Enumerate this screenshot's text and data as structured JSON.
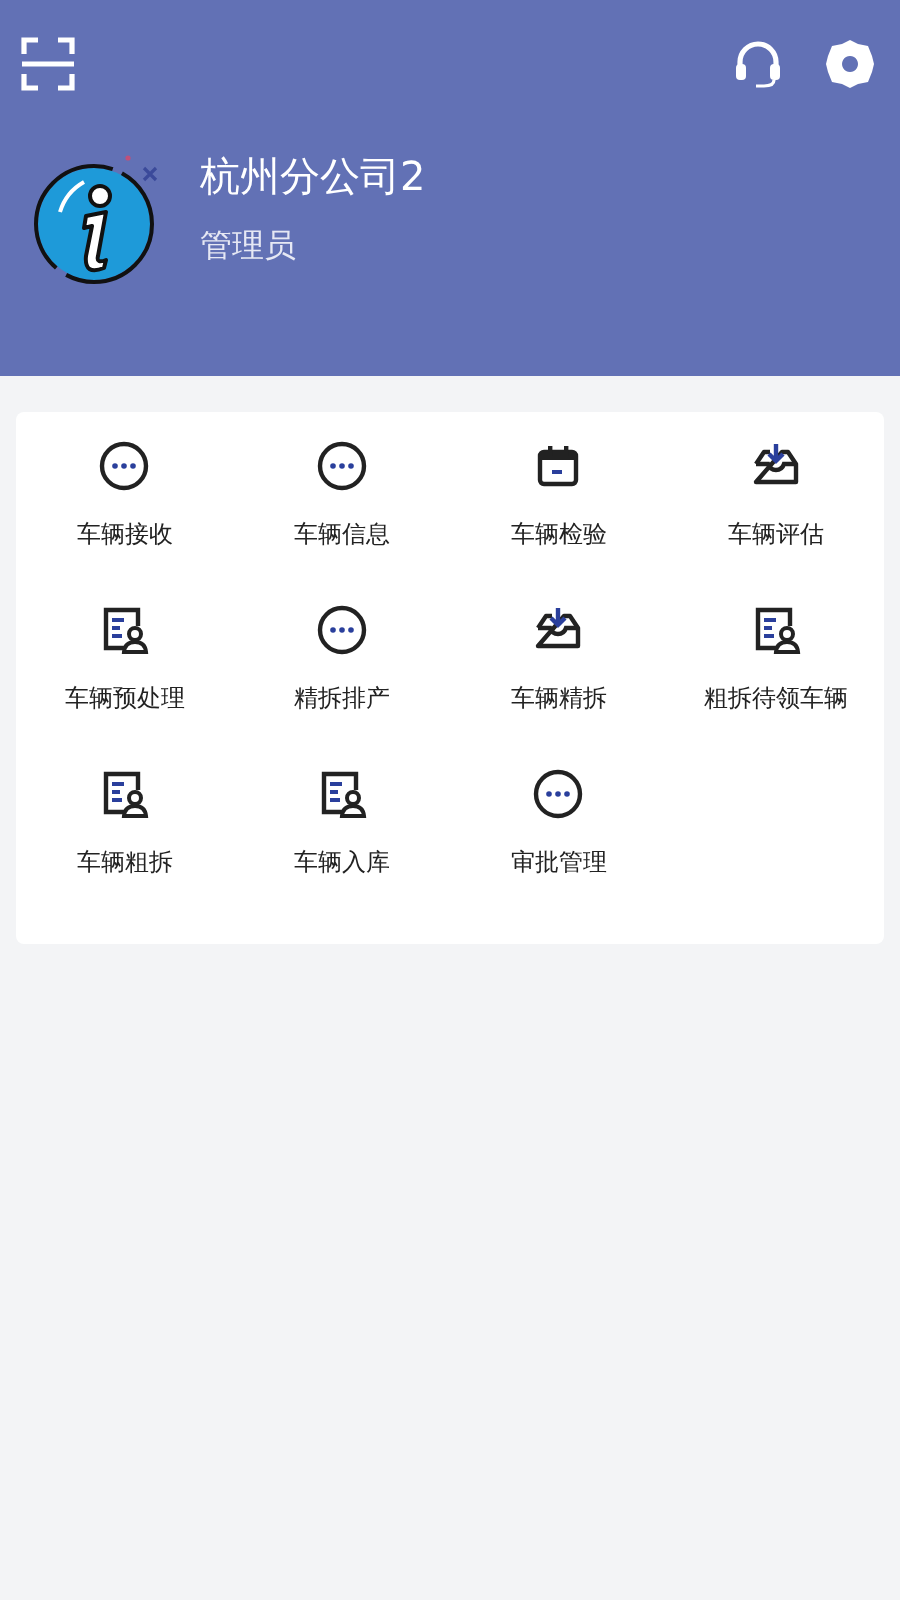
{
  "header": {
    "company": "杭州分公司2",
    "role": "管理员"
  },
  "menu": [
    {
      "label": "车辆接收",
      "kind": "dots"
    },
    {
      "label": "车辆信息",
      "kind": "dots"
    },
    {
      "label": "车辆检验",
      "kind": "calendar"
    },
    {
      "label": "车辆评估",
      "kind": "inbox"
    },
    {
      "label": "车辆预处理",
      "kind": "doc-user"
    },
    {
      "label": "精拆排产",
      "kind": "dots"
    },
    {
      "label": "车辆精拆",
      "kind": "inbox"
    },
    {
      "label": "粗拆待领车辆",
      "kind": "doc-user"
    },
    {
      "label": "车辆粗拆",
      "kind": "doc-user"
    },
    {
      "label": "车辆入库",
      "kind": "doc-user"
    },
    {
      "label": "审批管理",
      "kind": "dots"
    }
  ]
}
